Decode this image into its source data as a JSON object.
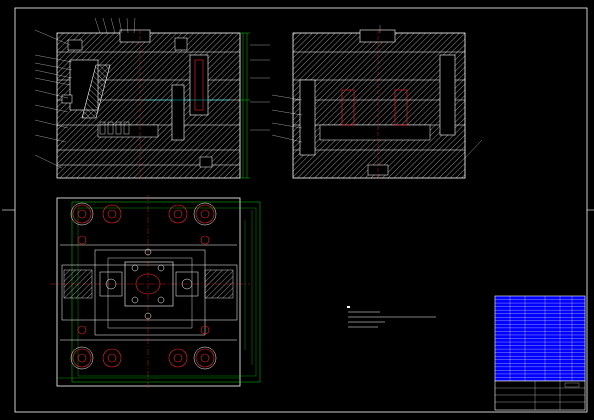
{
  "drawing": {
    "section_label_left": "",
    "section_label_right": "",
    "plan_view_label": "",
    "notes_heading": "",
    "notes": [],
    "title_block": {
      "part_name": "",
      "drawing_code": "",
      "scale": "",
      "sheet": ""
    },
    "bom_rows": 24
  },
  "colors": {
    "background": "#000000",
    "frame": "#ffffff",
    "geometry": "#ffffff",
    "hatch": "#c8c8c8",
    "dimension": "#00ff00",
    "centerline": "#ff2020",
    "leader": "#00ffff",
    "annotation": "#ffff00",
    "bom_fill": "#0000ff"
  }
}
